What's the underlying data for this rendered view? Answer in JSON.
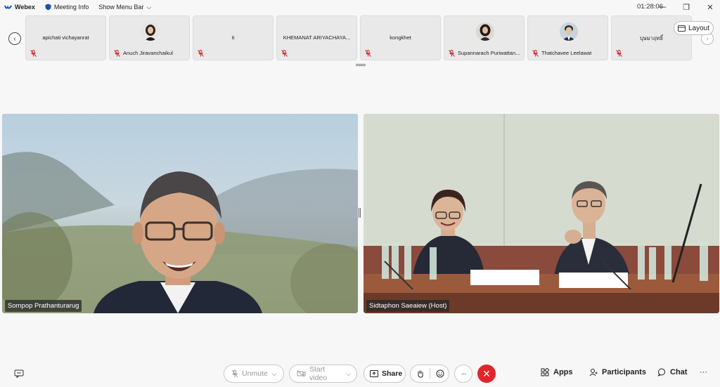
{
  "titlebar": {
    "app_name": "Webex",
    "meeting_info": "Meeting Info",
    "show_menu_bar": "Show Menu Bar",
    "time": "01:28:06"
  },
  "filmstrip": {
    "tiles": [
      {
        "name": "apichati vichayanrat",
        "has_avatar": false
      },
      {
        "name": "Anuch Jiravanchaikul",
        "has_avatar": true
      },
      {
        "name": "it",
        "has_avatar": false
      },
      {
        "name": "KHEMANAT ARIYACHAYA...",
        "has_avatar": false
      },
      {
        "name": "kongkhet",
        "has_avatar": false
      },
      {
        "name": "Supannarach Puriwattan...",
        "has_avatar": true
      },
      {
        "name": "Thatchavee Leelawat",
        "has_avatar": true
      },
      {
        "name": "บุษมาฤทธิ์",
        "has_avatar": false
      }
    ],
    "layout_label": "Layout"
  },
  "videos": [
    {
      "name": "Sompop Prathanturarug"
    },
    {
      "name": "Sidtaphon Saeaiew (Host)"
    }
  ],
  "controls": {
    "unmute": "Unmute",
    "start_video": "Start video",
    "share": "Share",
    "apps": "Apps",
    "participants": "Participants",
    "chat": "Chat",
    "more": "···"
  },
  "colors": {
    "end_call": "#e0262b",
    "mic_muted": "#d12a2a",
    "background": "#f7f7f7"
  }
}
